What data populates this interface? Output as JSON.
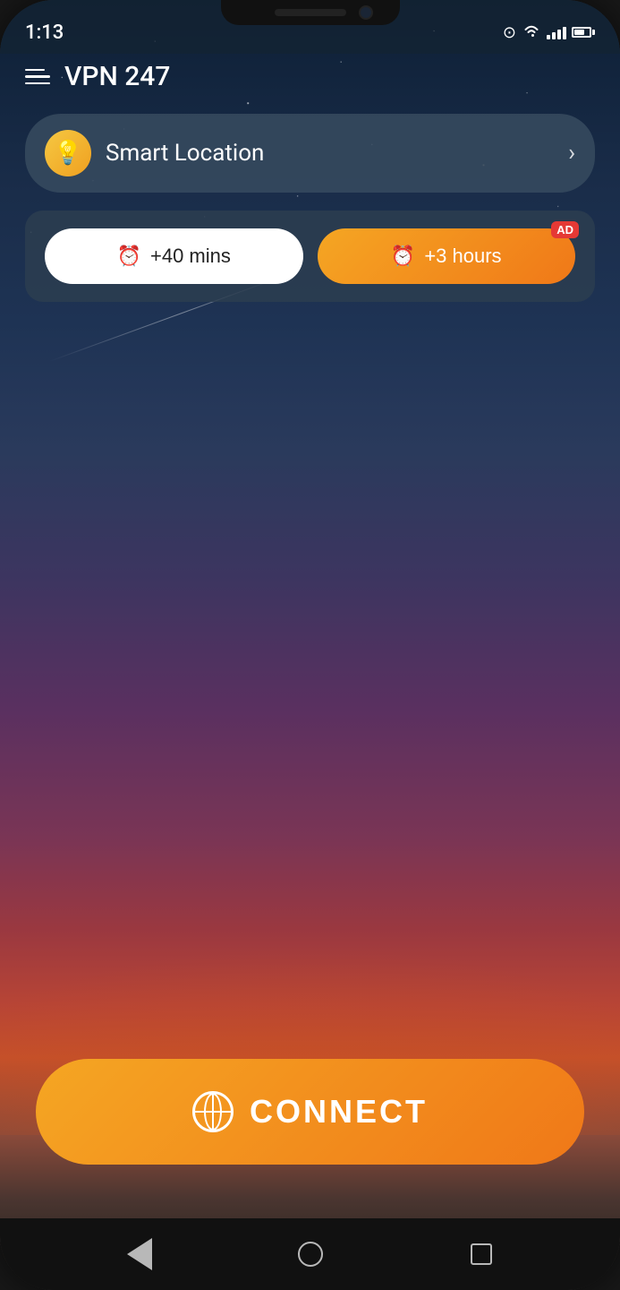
{
  "phone": {
    "status_bar": {
      "time": "1:13",
      "wifi": true,
      "signal": true,
      "battery": true
    },
    "app": {
      "title": "VPN 247",
      "menu_icon": "menu-icon",
      "location": {
        "label": "Smart Location",
        "icon": "💡",
        "arrow": "›"
      },
      "timers": {
        "option1": {
          "label": "+40 mins",
          "icon": "⏰",
          "style": "outline"
        },
        "option2": {
          "label": "+3 hours",
          "icon": "⏰",
          "style": "filled",
          "badge": "AD"
        }
      },
      "connect_button": {
        "label": "CONNECT",
        "icon": "globe"
      }
    },
    "nav_bar": {
      "back": "◀",
      "home": "●",
      "recent": "■"
    }
  }
}
